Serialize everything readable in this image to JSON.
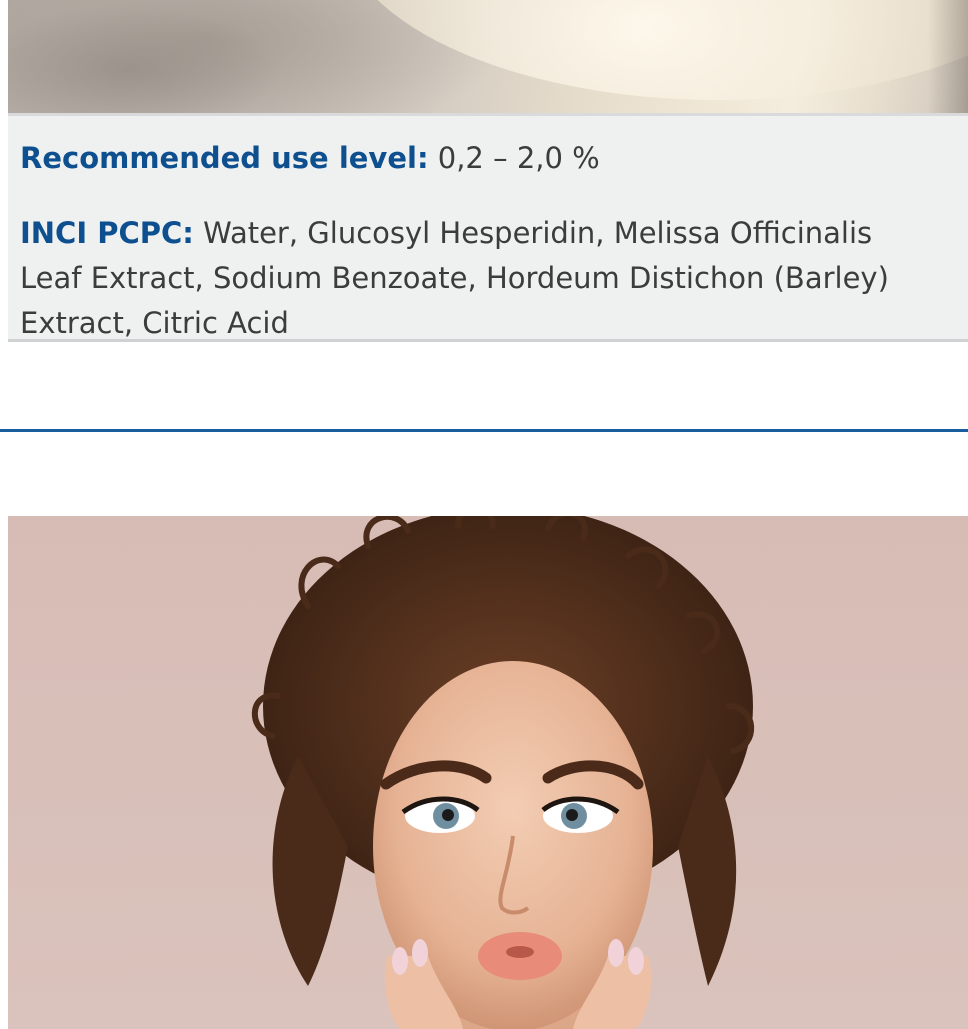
{
  "product_info": {
    "use_level_label": "Recommended use level:",
    "use_level_value": " 0,2 – 2,0 %",
    "inci_label": "INCI PCPC:",
    "inci_value": " Water, Glucosyl Hesperidin, Melissa Officinalis Leaf Extract, Sodium Benzoate, Hordeum Distichon (Barley) Extract, Citric Acid"
  },
  "colors": {
    "label_blue": "#0d4f8f",
    "divider_blue": "#1a5d9f",
    "info_box_bg": "#eff0f0"
  }
}
